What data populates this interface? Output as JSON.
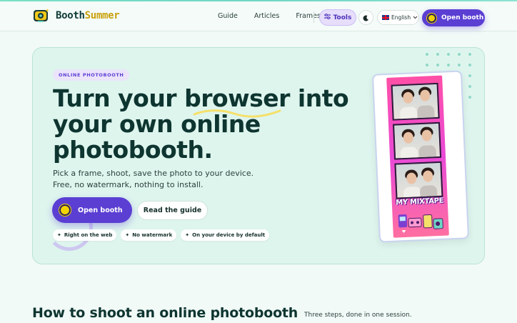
{
  "brand": {
    "name_part1": "Booth",
    "name_part2": "Summer",
    "accent": "#5b3fd3",
    "yellow": "#f2d300"
  },
  "nav": {
    "links": [
      "Guide",
      "Articles",
      "Frames"
    ],
    "tools_label": "Tools",
    "theme_icon": "moon-icon",
    "language_label": "English",
    "open_booth_label": "Open booth"
  },
  "hero": {
    "badge": "ONLINE PHOTOBOOTH",
    "headline": "Turn your browser into your own online photobooth.",
    "subtitle": "Pick a frame, shoot, save the photo to your device. Free, no watermark, nothing to install.",
    "cta_label": "Open booth",
    "guide_label": "Read the guide",
    "chips": [
      "Right on the web",
      "No watermark",
      "On your device by default"
    ],
    "strip_caption": "MY MIXTAPE"
  },
  "section": {
    "title": "How to shoot an online photobooth",
    "subtitle": "Three steps, done in one session."
  }
}
